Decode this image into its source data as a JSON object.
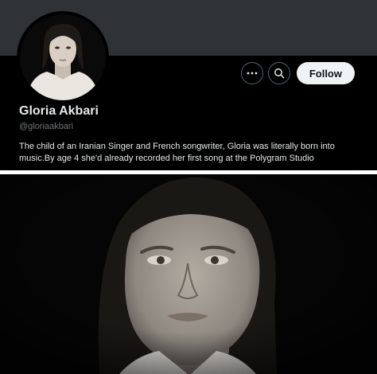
{
  "profile": {
    "name": "Gloria Akbari",
    "handle": "@gloriaakbari",
    "bio": "The child of an Iranian Singer and French songwriter, Gloria was literally born into music.By age 4 she'd already recorded her first song at the Polygram Studio"
  },
  "actions": {
    "more_icon": "more-icon",
    "search_icon": "search-icon",
    "follow_label": "Follow"
  }
}
